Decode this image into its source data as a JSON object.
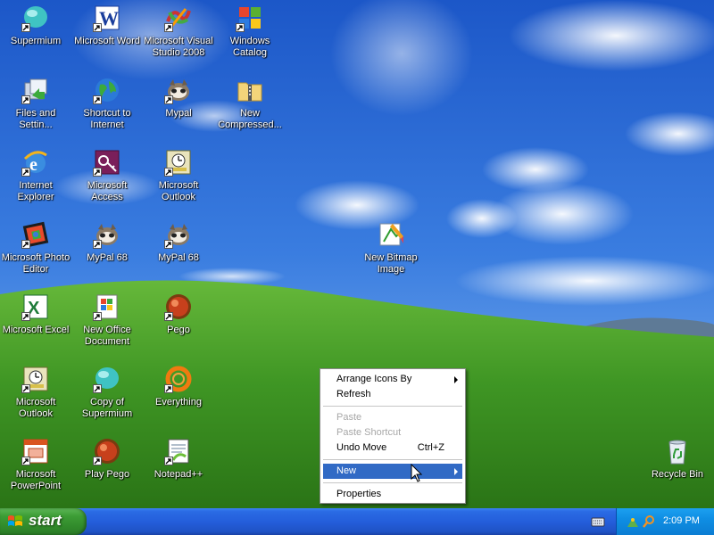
{
  "desktop": {
    "icons": [
      {
        "label": "Supermium",
        "icon": "supermium-icon"
      },
      {
        "label": "Microsoft Word",
        "icon": "word-icon"
      },
      {
        "label": "Microsoft Visual Studio 2008",
        "icon": "visual-studio-icon"
      },
      {
        "label": "Windows Catalog",
        "icon": "windows-catalog-icon"
      },
      {
        "label": "Files and Settin...",
        "icon": "files-settings-icon"
      },
      {
        "label": "Shortcut to Internet",
        "icon": "globe-icon"
      },
      {
        "label": "Mypal",
        "icon": "mypal-icon"
      },
      {
        "label": "New Compressed...",
        "icon": "zip-folder-icon"
      },
      {
        "label": "Internet Explorer",
        "icon": "internet-explorer-icon"
      },
      {
        "label": "Microsoft Access",
        "icon": "access-icon"
      },
      {
        "label": "Microsoft Outlook",
        "icon": "outlook-icon"
      },
      {
        "label": "Microsoft Photo Editor",
        "icon": "photo-editor-icon"
      },
      {
        "label": "MyPal 68",
        "icon": "mypal-icon"
      },
      {
        "label": "MyPal 68",
        "icon": "mypal-icon"
      },
      {
        "label": "New Bitmap Image",
        "icon": "bitmap-image-icon"
      },
      {
        "label": "Microsoft Excel",
        "icon": "excel-icon"
      },
      {
        "label": "New Office Document",
        "icon": "office-document-icon"
      },
      {
        "label": "Pego",
        "icon": "pego-icon"
      },
      {
        "label": "Microsoft Outlook",
        "icon": "outlook-icon"
      },
      {
        "label": "Copy of Supermium",
        "icon": "supermium-icon"
      },
      {
        "label": "Everything",
        "icon": "everything-icon"
      },
      {
        "label": "Microsoft PowerPoint",
        "icon": "powerpoint-icon"
      },
      {
        "label": "Play Pego",
        "icon": "pego-icon"
      },
      {
        "label": "Notepad++",
        "icon": "notepadpp-icon"
      },
      {
        "label": "Recycle Bin",
        "icon": "recycle-bin-icon"
      }
    ]
  },
  "context_menu": {
    "items": [
      {
        "label": "Arrange Icons By",
        "submenu": true,
        "disabled": false
      },
      {
        "label": "Refresh",
        "disabled": false
      },
      {
        "label": "Paste",
        "disabled": true
      },
      {
        "label": "Paste Shortcut",
        "disabled": true
      },
      {
        "label": "Undo Move",
        "shortcut": "Ctrl+Z",
        "disabled": false
      },
      {
        "label": "New",
        "submenu": true,
        "highlighted": true,
        "disabled": false
      },
      {
        "label": "Properties",
        "disabled": false
      }
    ]
  },
  "taskbar": {
    "start_label": "start",
    "clock": "2:09 PM"
  },
  "colors": {
    "taskbar_blue": "#245edb",
    "start_green": "#3c9c35",
    "menu_highlight": "#316ac5",
    "sky": "#2f6fd6",
    "grass": "#4a9a2a"
  }
}
